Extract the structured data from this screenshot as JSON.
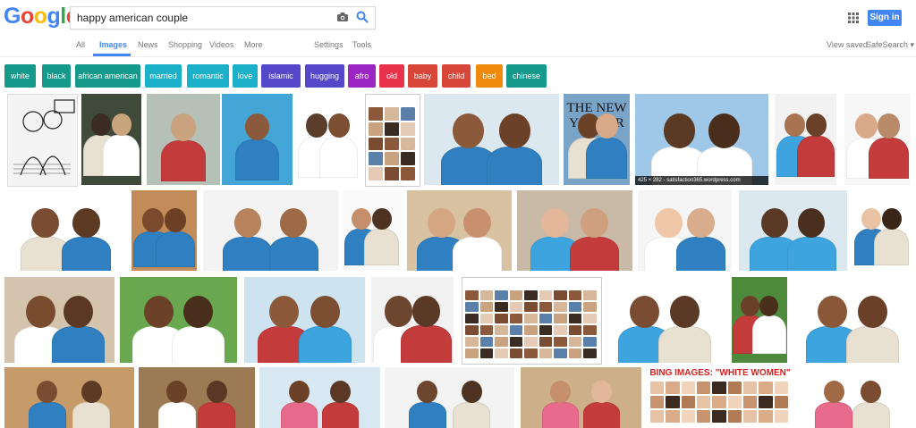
{
  "logo": {
    "letters": [
      "G",
      "o",
      "o",
      "g",
      "l",
      "e"
    ],
    "colors": [
      "#4285f4",
      "#ea4335",
      "#fbbc05",
      "#4285f4",
      "#34a853",
      "#ea4335"
    ]
  },
  "search": {
    "query": "happy american couple"
  },
  "header": {
    "signin_label": "Sign in",
    "icons": [
      "camera-icon",
      "search-icon",
      "apps-icon"
    ]
  },
  "nav": {
    "tabs": [
      "All",
      "Images",
      "News",
      "Shopping",
      "Videos",
      "More"
    ],
    "active": "Images",
    "settings": "Settings",
    "tools": "Tools",
    "view_saved": "View saved",
    "safesearch": "SafeSearch ▾"
  },
  "chips": [
    {
      "label": "white",
      "color": "#14998a"
    },
    {
      "label": "black",
      "color": "#14998a"
    },
    {
      "label": "african american",
      "color": "#14998a"
    },
    {
      "label": "married",
      "color": "#1ab1c9"
    },
    {
      "label": "romantic",
      "color": "#1ab1c9"
    },
    {
      "label": "love",
      "color": "#1ab1c9"
    },
    {
      "label": "islamic",
      "color": "#5447c9"
    },
    {
      "label": "hugging",
      "color": "#5447c9"
    },
    {
      "label": "afro",
      "color": "#9a25c2"
    },
    {
      "label": "old",
      "color": "#e8324a"
    },
    {
      "label": "baby",
      "color": "#d8463a"
    },
    {
      "label": "child",
      "color": "#d8463a"
    },
    {
      "label": "bed",
      "color": "#f08a0d"
    },
    {
      "label": "chinese",
      "color": "#14998a"
    }
  ],
  "images": {
    "rows": [
      [
        {
          "kind": "cartoon",
          "bg": "#f4f4f4",
          "people": [
            "#fff",
            "#fff"
          ]
        },
        {
          "kind": "photo",
          "bg": "#3f4a3a",
          "people": [
            "#3a2c22",
            "#c9a57e"
          ]
        },
        {
          "kind": "photo",
          "bg": "#b5c0b7",
          "people": [
            "#c9a27f"
          ]
        },
        {
          "kind": "photo",
          "bg": "#43a6d6",
          "people": [
            "#8b5a3c"
          ]
        },
        {
          "kind": "photo",
          "bg": "#ffffff",
          "people": [
            "#5b3d2b",
            "#7a4f33"
          ]
        },
        {
          "kind": "screenshot",
          "bg": "#ffffff"
        },
        {
          "kind": "photo",
          "bg": "#dbe8ef",
          "people": [
            "#8c5a3a",
            "#6b4128"
          ]
        },
        {
          "kind": "magazine",
          "bg": "#7aa4c7",
          "title": "THE NEW YORKER"
        },
        {
          "kind": "photo",
          "bg": "#9fc7e8",
          "people": [
            "#5a3a25",
            "#4a2e1c"
          ],
          "caption": "425 × 282 - satisfaction365.wordpress.com"
        },
        {
          "kind": "photo",
          "bg": "#f2f2f2",
          "people": [
            "#a87350",
            "#6a4128"
          ]
        },
        {
          "kind": "photo",
          "bg": "#f7f7f7",
          "people": [
            "#d9a98a",
            "#b88a6a"
          ]
        }
      ],
      [
        {
          "kind": "photo",
          "bg": "#ffffff",
          "people": [
            "#7a4d32",
            "#5d3a24"
          ]
        },
        {
          "kind": "photo",
          "bg": "#c28b5a",
          "people": [
            "#7b4a2c",
            "#6d3f25"
          ]
        },
        {
          "kind": "photo",
          "bg": "#f3f3f3",
          "people": [
            "#b7835d",
            "#9e6a46"
          ]
        },
        {
          "kind": "photo",
          "bg": "#fafafa",
          "people": [
            "#c68f6b",
            "#4e3322"
          ]
        },
        {
          "kind": "photo",
          "bg": "#d9c2a2",
          "people": [
            "#d6a582",
            "#c99070"
          ]
        },
        {
          "kind": "photo",
          "bg": "#c9b9a7",
          "people": [
            "#e2b79a",
            "#cf9f80"
          ]
        },
        {
          "kind": "photo",
          "bg": "#f5f5f5",
          "people": [
            "#efc7a8",
            "#d9ac8c"
          ]
        },
        {
          "kind": "photo",
          "bg": "#dce8ef",
          "people": [
            "#5a3a26",
            "#4a2f1f"
          ]
        },
        {
          "kind": "photo",
          "bg": "#ffffff",
          "people": [
            "#eac2a4",
            "#3a2619"
          ]
        }
      ],
      [
        {
          "kind": "photo",
          "bg": "#d4c3ad",
          "people": [
            "#7a4c2f",
            "#5a3825"
          ]
        },
        {
          "kind": "photo",
          "bg": "#6aa850",
          "people": [
            "#6b4128",
            "#4a2e1c"
          ]
        },
        {
          "kind": "photo",
          "bg": "#cde3ef",
          "people": [
            "#8c5a3a",
            "#7c4f33"
          ]
        },
        {
          "kind": "photo",
          "bg": "#f1f1f1",
          "people": [
            "#6d4630",
            "#5a3a26"
          ]
        },
        {
          "kind": "screenshot",
          "bg": "#ffffff"
        },
        {
          "kind": "photo",
          "bg": "#ffffff",
          "people": [
            "#7a4d32",
            "#5a3a26"
          ]
        },
        {
          "kind": "photo",
          "bg": "#4e8a3c",
          "people": [
            "#6a4128",
            "#4a2e1c"
          ]
        },
        {
          "kind": "photo",
          "bg": "#ffffff",
          "people": [
            "#8a5838",
            "#6a4128"
          ]
        }
      ],
      [
        {
          "kind": "photo",
          "bg": "#c79a6a",
          "people": [
            "#7a4d32",
            "#5d3a24"
          ]
        },
        {
          "kind": "photo",
          "bg": "#9c7a54",
          "people": [
            "#6b4128",
            "#5a3825"
          ]
        },
        {
          "kind": "photo",
          "bg": "#d7e8f2",
          "people": [
            "#6b4128",
            "#5a3825"
          ]
        },
        {
          "kind": "photo",
          "bg": "#f3f3f3",
          "people": [
            "#6d4630",
            "#4e3322"
          ]
        },
        {
          "kind": "photo",
          "bg": "#cdb08a",
          "people": [
            "#c68f6b",
            "#e2b79a"
          ]
        },
        {
          "kind": "collage",
          "bg": "#2a2a2a",
          "title": "BING IMAGES: \"WHITE WOMEN\""
        },
        {
          "kind": "photo",
          "bg": "#ffffff",
          "people": [
            "#a06a45",
            "#7a4d32"
          ]
        }
      ]
    ]
  }
}
